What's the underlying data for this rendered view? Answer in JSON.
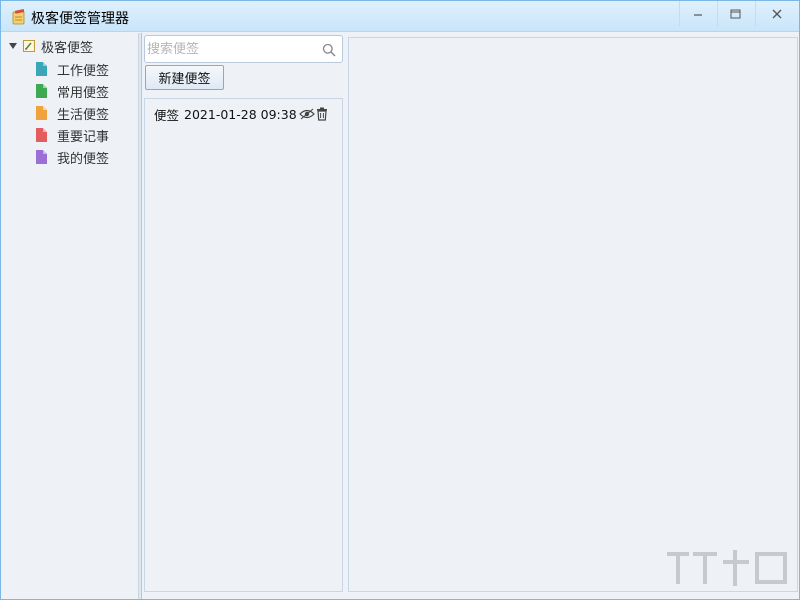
{
  "window": {
    "title": "极客便签管理器",
    "icons": {
      "app": "notepad-icon",
      "minimize": "minimize-icon",
      "maximize": "maximize-icon",
      "close": "close-icon"
    }
  },
  "tree": {
    "root": {
      "label": "极客便签",
      "icon": "notebook-icon",
      "expanded": true
    },
    "items": [
      {
        "label": "工作便签",
        "color": "#3aa6b6"
      },
      {
        "label": "常用便签",
        "color": "#3daa52"
      },
      {
        "label": "生活便签",
        "color": "#f0a33c"
      },
      {
        "label": "重要记事",
        "color": "#e45d5d"
      },
      {
        "label": "我的便签",
        "color": "#9b6fd6"
      }
    ]
  },
  "search": {
    "placeholder": "搜索便签",
    "value": "",
    "icon": "search-icon"
  },
  "toolbar": {
    "new_label": "新建便签"
  },
  "notes": [
    {
      "title": "便签",
      "datetime": "2021-01-28 09:38",
      "icons": [
        "eye-icon",
        "trash-icon"
      ]
    }
  ],
  "colors": {
    "accent": "#7ab6e6",
    "panel_bg": "#eef2f7",
    "titlebar": "#c9e5fa"
  }
}
